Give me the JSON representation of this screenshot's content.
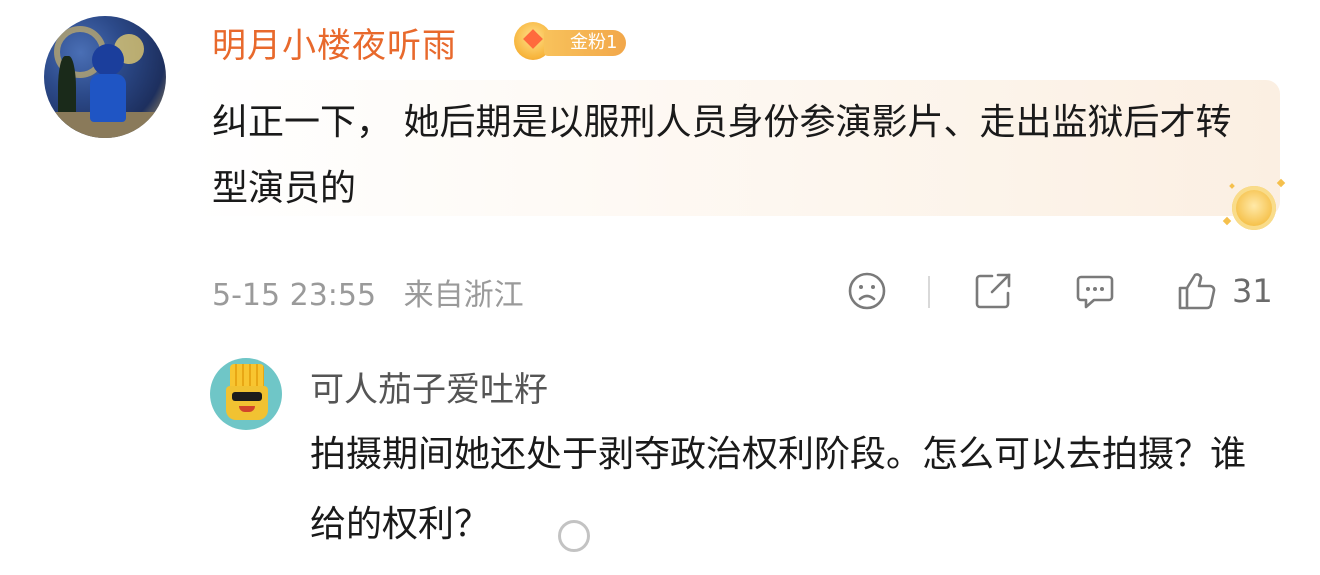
{
  "main_comment": {
    "username": "明月小楼夜听雨",
    "fan_badge": "金粉1",
    "text": "纠正一下， 她后期是以服刑人员身份参演影片、走出监狱后才转型演员的",
    "timestamp": "5-15 23:55",
    "location": "来自浙江",
    "like_count": "31",
    "icons": {
      "dislike": "frown-face-icon",
      "share": "share-icon",
      "comment": "comment-icon",
      "like": "thumbs-up-icon"
    }
  },
  "reply": {
    "username": "可人茄子爱吐籽",
    "text": "拍摄期间她还处于剥夺政治权利阶段。怎么可以去拍摄？谁给的权利？"
  },
  "colors": {
    "username_main": "#e8692c",
    "badge": "#f2a74a",
    "meta": "#9a9a9a",
    "text": "#1a1a1a"
  }
}
